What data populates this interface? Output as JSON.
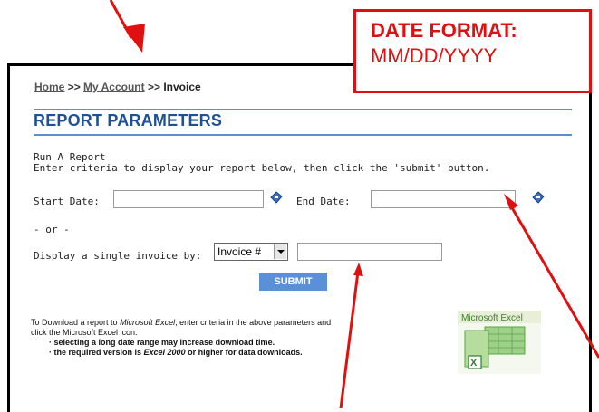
{
  "annotation": {
    "title": "DATE FORMAT:",
    "format": "MM/DD/YYYY",
    "color": "#e01010"
  },
  "breadcrumb": {
    "home": "Home",
    "sep1": ">>",
    "account": "My Account",
    "sep2": ">>",
    "current": "Invoice"
  },
  "page": {
    "heading": "REPORT PARAMETERS",
    "intro_line1": "Run A Report",
    "intro_line2": "Enter criteria to display your report below, then click the 'submit' button."
  },
  "form": {
    "start_label": "Start Date:",
    "end_label": "End Date:",
    "or_label": "- or -",
    "single_label": "Display a single invoice by:",
    "select_value": "Invoice #",
    "submit_label": "SUBMIT"
  },
  "download": {
    "line1_a": "To Download",
    "line1_b": " a report to ",
    "line1_c": "Microsoft Excel",
    "line1_d": ", enter criteria in the above parameters and",
    "line2": "click the Microsoft Excel icon.",
    "bullet1": "· selecting a long date range may increase download time.",
    "bullet2_a": "· the required version is ",
    "bullet2_b": "Excel 2000",
    "bullet2_c": " or higher for data downloads.",
    "excel_label": "Microsoft Excel"
  },
  "colors": {
    "accent_blue": "#1f4f95",
    "rule_blue": "#5b8fd1",
    "submit_bg": "#5b8fd8",
    "excel_green": "#3f9e3f"
  }
}
